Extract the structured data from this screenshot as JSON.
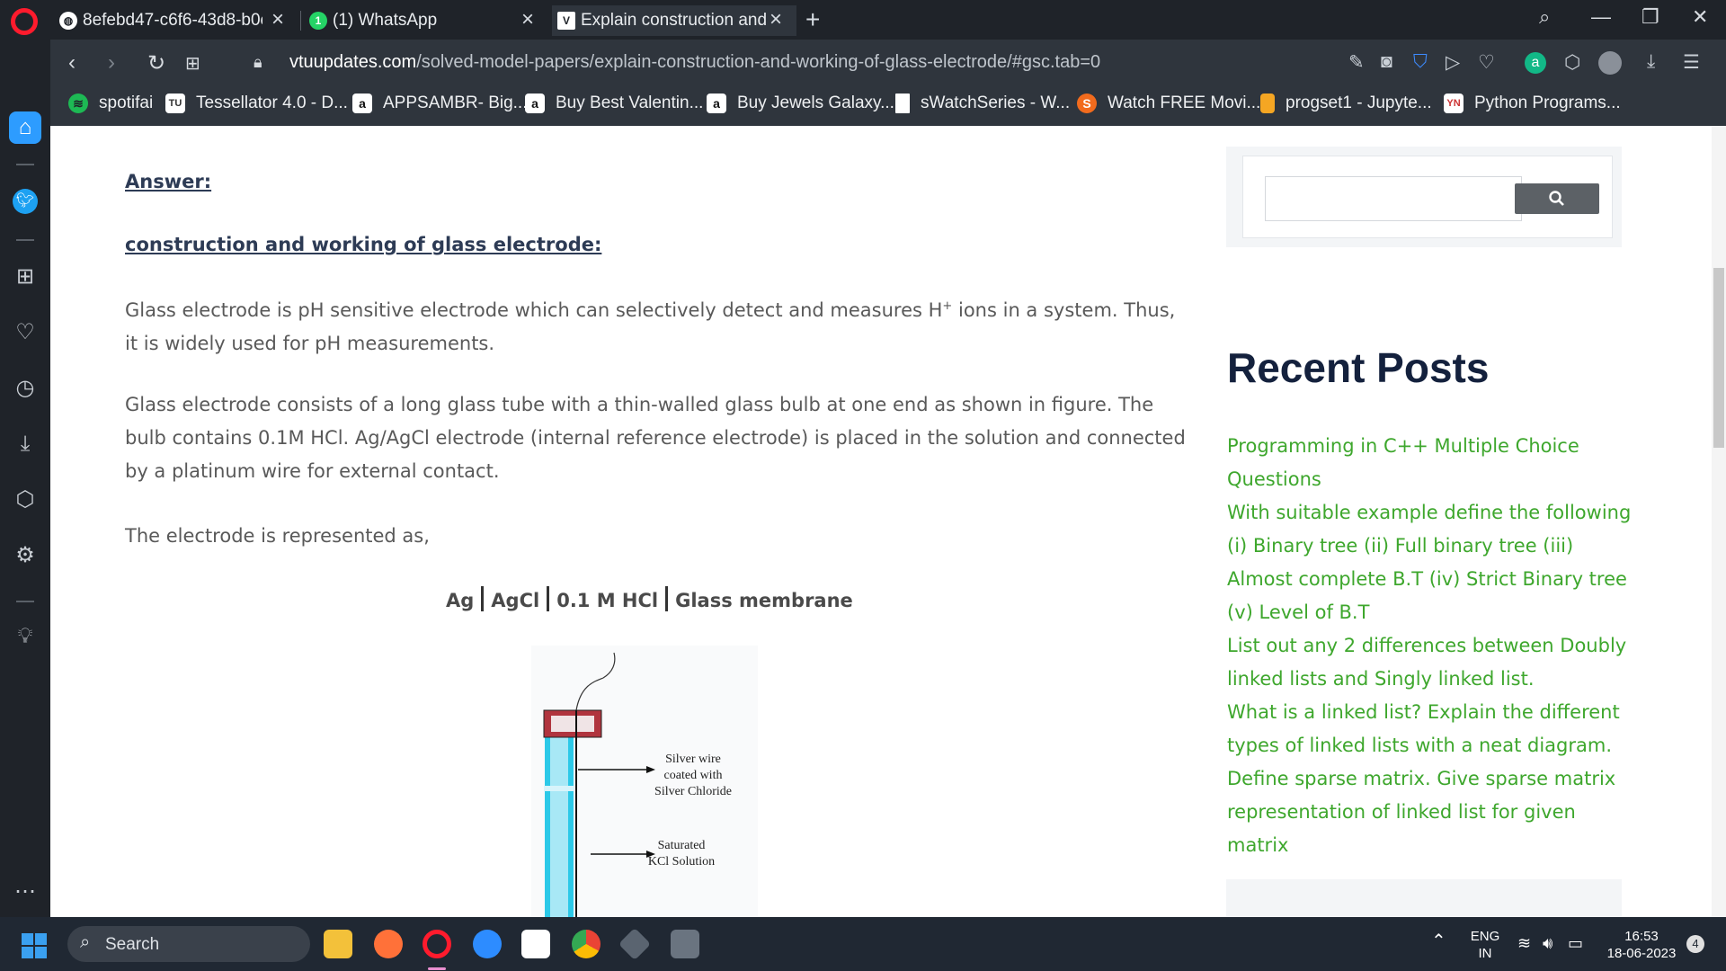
{
  "browser": {
    "tabs": [
      {
        "title": "8efebd47-c6f6-43d8-b0e",
        "active": false
      },
      {
        "title": "(1) WhatsApp",
        "active": false
      },
      {
        "title": "Explain construction and",
        "active": true
      }
    ],
    "url_domain": "vtuupdates.com",
    "url_path": "/solved-model-papers/explain-construction-and-working-of-glass-electrode/#gsc.tab=0",
    "bookmarks": [
      "spotifai",
      "Tessellator 4.0 - D...",
      "APPSAMBR- Big...",
      "Buy Best Valentin...",
      "Buy Jewels Galaxy...",
      "sWatchSeries - W...",
      "Watch FREE Movi...",
      "progset1 - Jupyte...",
      "Python Programs..."
    ]
  },
  "article": {
    "answer_label": "Answer:",
    "heading": "construction and working of glass electrode:",
    "para1_a": "Glass electrode is pH sensitive electrode which can selectively detect and measures H",
    "para1_sup": "+",
    "para1_b": " ions in a system. Thus, it is widely used for pH measurements.",
    "para2": "Glass electrode consists of a long glass tube with a thin-walled glass bulb at one end as shown in figure. The bulb contains 0.1M HCl. Ag/AgCl electrode (internal reference electrode) is placed in the solution and connected by a platinum wire for external contact.",
    "para3": "The electrode is represented as,",
    "notation": [
      "Ag",
      "AgCl",
      "0.1 M HCl",
      "Glass membrane"
    ],
    "figure_labels": {
      "silver_wire": [
        "Silver wire",
        "coated with",
        "Silver Chloride"
      ],
      "kcl": [
        "Saturated",
        "KCl Solution"
      ]
    }
  },
  "sidebar_right": {
    "recent_posts_title": "Recent Posts",
    "posts": [
      "Programming in C++ Multiple Choice Questions",
      "With suitable example define the following (i) Binary tree (ii) Full binary tree (iii) Almost complete B.T (iv) Strict Binary tree (v) Level of B.T",
      "List out any 2 differences between Doubly linked lists and Singly linked list.",
      "What is a linked list? Explain the different types of linked lists with a neat diagram.",
      "Define sparse matrix. Give sparse matrix representation of linked list for given matrix"
    ]
  },
  "taskbar": {
    "search_label": "Search",
    "lang_line1": "ENG",
    "lang_line2": "IN",
    "time": "16:53",
    "date": "18-06-2023",
    "notification_count": "4"
  },
  "colors": {
    "link_green": "#3ea72d",
    "heading_navy": "#14213d",
    "opera_red": "#ff1b2d"
  }
}
